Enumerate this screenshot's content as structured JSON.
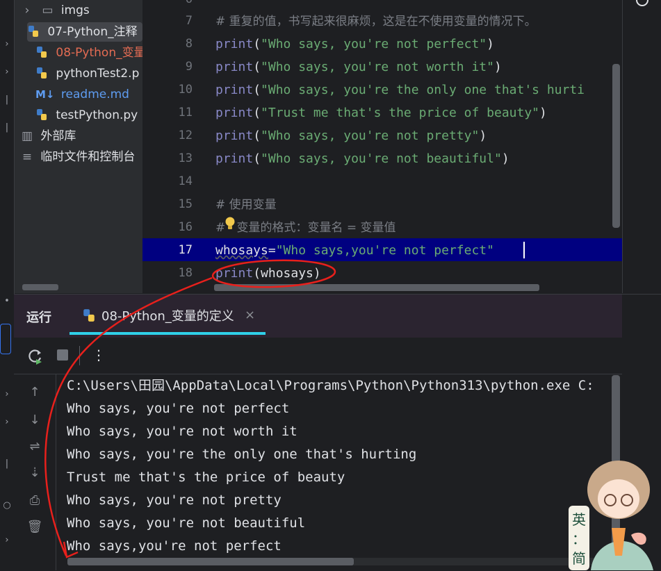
{
  "project_tree": {
    "items": [
      {
        "label": "imgs",
        "type": "folder",
        "expanded": false
      },
      {
        "label": "07-Python_注释",
        "type": "python",
        "selected": true
      },
      {
        "label": "08-Python_变量",
        "type": "python",
        "modified": true
      },
      {
        "label": "pythonTest2.p",
        "type": "python"
      },
      {
        "label": "readme.md",
        "type": "markdown"
      },
      {
        "label": "testPython.py",
        "type": "python"
      },
      {
        "label": "外部库",
        "type": "library"
      },
      {
        "label": "临时文件和控制台",
        "type": "scratches"
      }
    ]
  },
  "editor": {
    "current_line": 17,
    "line_numbers": [
      "6",
      "7",
      "8",
      "9",
      "10",
      "11",
      "12",
      "13",
      "14",
      "15",
      "16",
      "17",
      "18"
    ],
    "lines": [
      {
        "comment": "# 重复的值，书写起来很麻烦，这是在不使用变量的情况下。"
      },
      {
        "fn": "print",
        "open": "(",
        "str": "\"Who says, you're not perfect\"",
        "close": ")"
      },
      {
        "fn": "print",
        "open": "(",
        "str": "\"Who says, you're not worth it\"",
        "close": ")"
      },
      {
        "fn": "print",
        "open": "(",
        "str": "\"Who says, you're the only one that's hurti",
        "close": ""
      },
      {
        "fn": "print",
        "open": "(",
        "str": "\"Trust me that's the price of beauty\"",
        "close": ")"
      },
      {
        "fn": "print",
        "open": "(",
        "str": "\"Who says, you're not pretty\"",
        "close": ")"
      },
      {
        "fn": "print",
        "open": "(",
        "str": "\"Who says, you're not beautiful\"",
        "close": ")"
      },
      {
        "comment": ""
      },
      {
        "comment": "# 使用变量"
      },
      {
        "comment": "#   变量的格式：变量名 = 变量值"
      },
      {
        "var": "whosays",
        "eq": "=",
        "str": "\"Who says,you're not perfect\""
      },
      {
        "fn": "print",
        "open": "(",
        "arg": "whosays",
        "close": ")"
      }
    ]
  },
  "run_panel": {
    "title": "运行",
    "tab_label": "08-Python_变量的定义",
    "close_glyph": "×",
    "more_glyph": "⋮",
    "console_lines": [
      "C:\\Users\\田园\\AppData\\Local\\Programs\\Python\\Python313\\python.exe C:",
      "Who says, you're not perfect",
      "Who says, you're not worth it",
      "Who says, you're the only one that's hurting",
      "Trust me that's the price of beauty",
      "Who says, you're not pretty",
      "Who says, you're not beautiful",
      "Who says,you're not perfect"
    ]
  },
  "ime_badge": {
    "top": "英",
    "mid": "：",
    "bottom": "简"
  },
  "colors": {
    "background": "#1e1f22",
    "panel": "#2b2d30",
    "current_line": "#000080",
    "string": "#6aab73",
    "builtin": "#8888c6",
    "annotation": "#e8201c",
    "tab_underline": "#2fd0e8"
  },
  "icons": [
    "chevron-right-icon",
    "folder-icon",
    "python-file-icon",
    "markdown-icon",
    "library-icon",
    "scratches-icon",
    "bulb-icon",
    "rerun-icon",
    "stop-icon",
    "more-icon",
    "up-arrow-icon",
    "down-arrow-icon",
    "soft-wrap-icon",
    "scroll-to-end-icon",
    "print-icon",
    "trash-icon",
    "close-icon"
  ]
}
